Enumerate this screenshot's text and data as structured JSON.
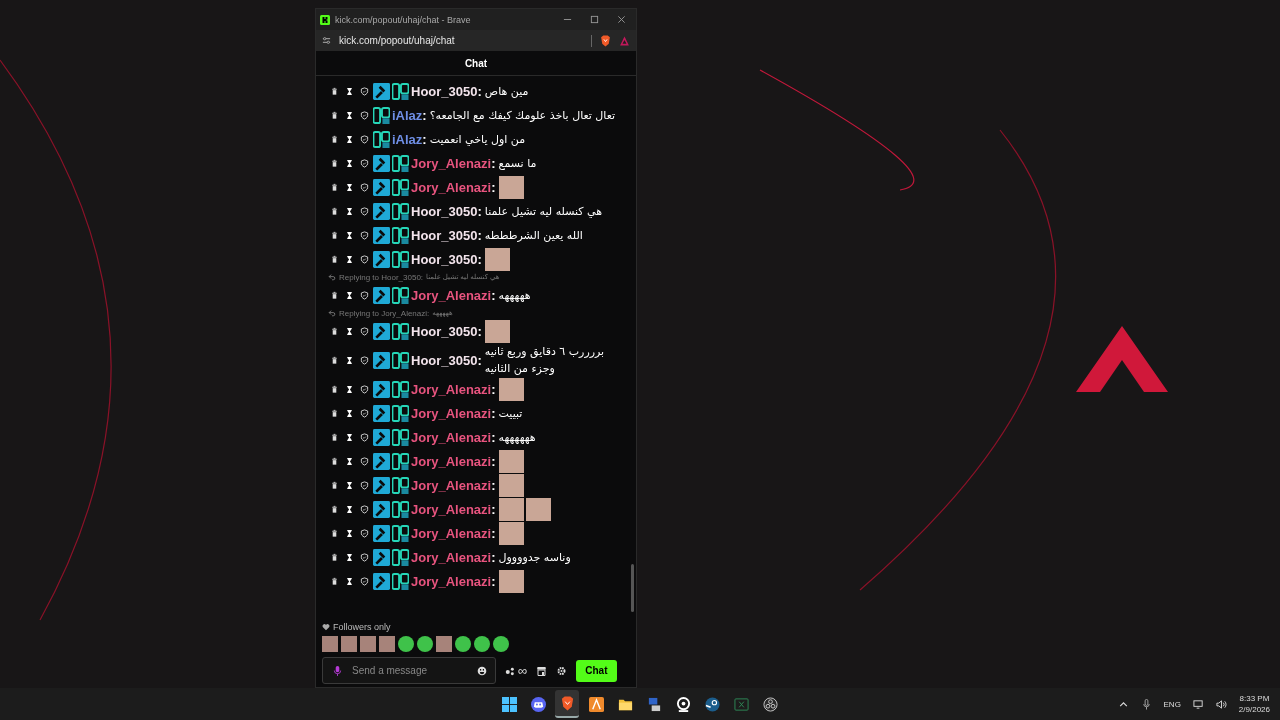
{
  "window": {
    "title": "kick.com/popout/uhaj/chat - Brave",
    "address": "kick.com/popout/uhaj/chat"
  },
  "chat_header": "Chat",
  "messages": [
    {
      "user": "Hoor_3050",
      "color": "#f3e4ec",
      "badges": [
        {
          "kind": "mod"
        },
        {
          "kind": "og"
        }
      ],
      "colon": ":",
      "kind": "text",
      "text": "مين هاص"
    },
    {
      "user": "iAlaz",
      "color": "#6f8fe6",
      "badges": [
        {
          "kind": "og"
        }
      ],
      "colon": ":",
      "kind": "text",
      "text": "تعال تعال باخذ علومك كيفك مع الجامعه؟"
    },
    {
      "user": "iAlaz",
      "color": "#6f8fe6",
      "badges": [
        {
          "kind": "og"
        }
      ],
      "colon": ":",
      "kind": "text",
      "text": "من اول ياخي انعميت"
    },
    {
      "user": "Jory_Alenazi",
      "color": "#e8547f",
      "badges": [
        {
          "kind": "mod"
        },
        {
          "kind": "og"
        }
      ],
      "colon": ":",
      "kind": "text",
      "text": "ما نسمع"
    },
    {
      "user": "Jory_Alenazi",
      "color": "#e8547f",
      "badges": [
        {
          "kind": "mod"
        },
        {
          "kind": "og"
        }
      ],
      "colon": ":",
      "kind": "emote",
      "emotes": [
        {
          "kind": "photo"
        }
      ]
    },
    {
      "user": "Hoor_3050",
      "color": "#f3e4ec",
      "badges": [
        {
          "kind": "mod"
        },
        {
          "kind": "og"
        }
      ],
      "colon": ":",
      "kind": "text",
      "text": "هي كنسله ليه تشيل علمنا"
    },
    {
      "user": "Hoor_3050",
      "color": "#f3e4ec",
      "badges": [
        {
          "kind": "mod"
        },
        {
          "kind": "og"
        }
      ],
      "colon": ":",
      "kind": "text",
      "text": "الله يعين الشرطططه"
    },
    {
      "user": "Hoor_3050",
      "color": "#f3e4ec",
      "badges": [
        {
          "kind": "mod"
        },
        {
          "kind": "og"
        }
      ],
      "colon": ":",
      "kind": "emote",
      "emotes": [
        {
          "kind": "photo"
        }
      ]
    },
    {
      "reply": {
        "label": "Replying to Hoor_3050:",
        "quote": "هي كنسله ليه تشيل علمنا"
      },
      "user": "Jory_Alenazi",
      "color": "#e8547f",
      "badges": [
        {
          "kind": "mod"
        },
        {
          "kind": "og"
        }
      ],
      "colon": ":",
      "kind": "text",
      "text": "هههههه"
    },
    {
      "reply": {
        "label": "Replying to Jory_Alenazi:",
        "quote": "هههههه"
      },
      "user": "Hoor_3050",
      "color": "#f3e4ec",
      "badges": [
        {
          "kind": "mod"
        },
        {
          "kind": "og"
        }
      ],
      "colon": ":",
      "kind": "emote",
      "emotes": [
        {
          "kind": "photo"
        }
      ]
    },
    {
      "user": "Hoor_3050",
      "color": "#f3e4ec",
      "badges": [
        {
          "kind": "mod"
        },
        {
          "kind": "og"
        }
      ],
      "colon": ":",
      "kind": "text",
      "text": "بررررب ٦ دقايق وربع ثانيه وجزء من الثانيه"
    },
    {
      "user": "Jory_Alenazi",
      "color": "#e8547f",
      "badges": [
        {
          "kind": "mod"
        },
        {
          "kind": "og"
        }
      ],
      "colon": ":",
      "kind": "emote",
      "emotes": [
        {
          "kind": "photo"
        }
      ]
    },
    {
      "user": "Jory_Alenazi",
      "color": "#e8547f",
      "badges": [
        {
          "kind": "mod"
        },
        {
          "kind": "og"
        }
      ],
      "colon": ":",
      "kind": "text",
      "text": "تبييت"
    },
    {
      "user": "Jory_Alenazi",
      "color": "#e8547f",
      "badges": [
        {
          "kind": "mod"
        },
        {
          "kind": "og"
        }
      ],
      "colon": ":",
      "kind": "text",
      "text": "ههههههه"
    },
    {
      "user": "Jory_Alenazi",
      "color": "#e8547f",
      "badges": [
        {
          "kind": "mod"
        },
        {
          "kind": "og"
        }
      ],
      "colon": ":",
      "kind": "emote",
      "emotes": [
        {
          "kind": "photo"
        }
      ]
    },
    {
      "user": "Jory_Alenazi",
      "color": "#e8547f",
      "badges": [
        {
          "kind": "mod"
        },
        {
          "kind": "og"
        }
      ],
      "colon": ":",
      "kind": "emote",
      "emotes": [
        {
          "kind": "photo"
        }
      ]
    },
    {
      "user": "Jory_Alenazi",
      "color": "#e8547f",
      "badges": [
        {
          "kind": "mod"
        },
        {
          "kind": "og"
        }
      ],
      "colon": ":",
      "kind": "emote",
      "emotes": [
        {
          "kind": "photo"
        },
        {
          "kind": "photo"
        }
      ]
    },
    {
      "user": "Jory_Alenazi",
      "color": "#e8547f",
      "badges": [
        {
          "kind": "mod"
        },
        {
          "kind": "og"
        }
      ],
      "colon": ":",
      "kind": "emote",
      "emotes": [
        {
          "kind": "photo"
        }
      ]
    },
    {
      "user": "Jory_Alenazi",
      "color": "#e8547f",
      "badges": [
        {
          "kind": "mod"
        },
        {
          "kind": "og"
        }
      ],
      "colon": ":",
      "kind": "text",
      "text": "وناسه جدوووول"
    },
    {
      "user": "Jory_Alenazi",
      "color": "#e8547f",
      "badges": [
        {
          "kind": "mod"
        },
        {
          "kind": "og"
        }
      ],
      "colon": ":",
      "kind": "emote",
      "emotes": [
        {
          "kind": "photo"
        }
      ]
    }
  ],
  "followers_notice": "Followers only",
  "emote_bar": [
    {
      "kind": "photo"
    },
    {
      "kind": "photo"
    },
    {
      "kind": "photo"
    },
    {
      "kind": "photo"
    },
    {
      "kind": "sticker"
    },
    {
      "kind": "sticker"
    },
    {
      "kind": "photo"
    },
    {
      "kind": "sticker"
    },
    {
      "kind": "sticker"
    },
    {
      "kind": "sticker"
    }
  ],
  "composer": {
    "placeholder": "Send a message",
    "infinity": "∞",
    "send_button": "Chat"
  },
  "taskbar": {
    "apps": [
      {
        "kind": "start",
        "selected": false
      },
      {
        "kind": "discord",
        "selected": false
      },
      {
        "kind": "brave",
        "selected": true
      },
      {
        "kind": "orange",
        "selected": false
      },
      {
        "kind": "folder",
        "selected": false
      },
      {
        "kind": "network",
        "selected": false
      },
      {
        "kind": "camera",
        "selected": false
      },
      {
        "kind": "steam",
        "selected": false
      },
      {
        "kind": "sheet",
        "selected": false
      },
      {
        "kind": "obs",
        "selected": false
      }
    ],
    "language": "ENG",
    "time": "8:33 PM",
    "date": "2/9/2026"
  }
}
